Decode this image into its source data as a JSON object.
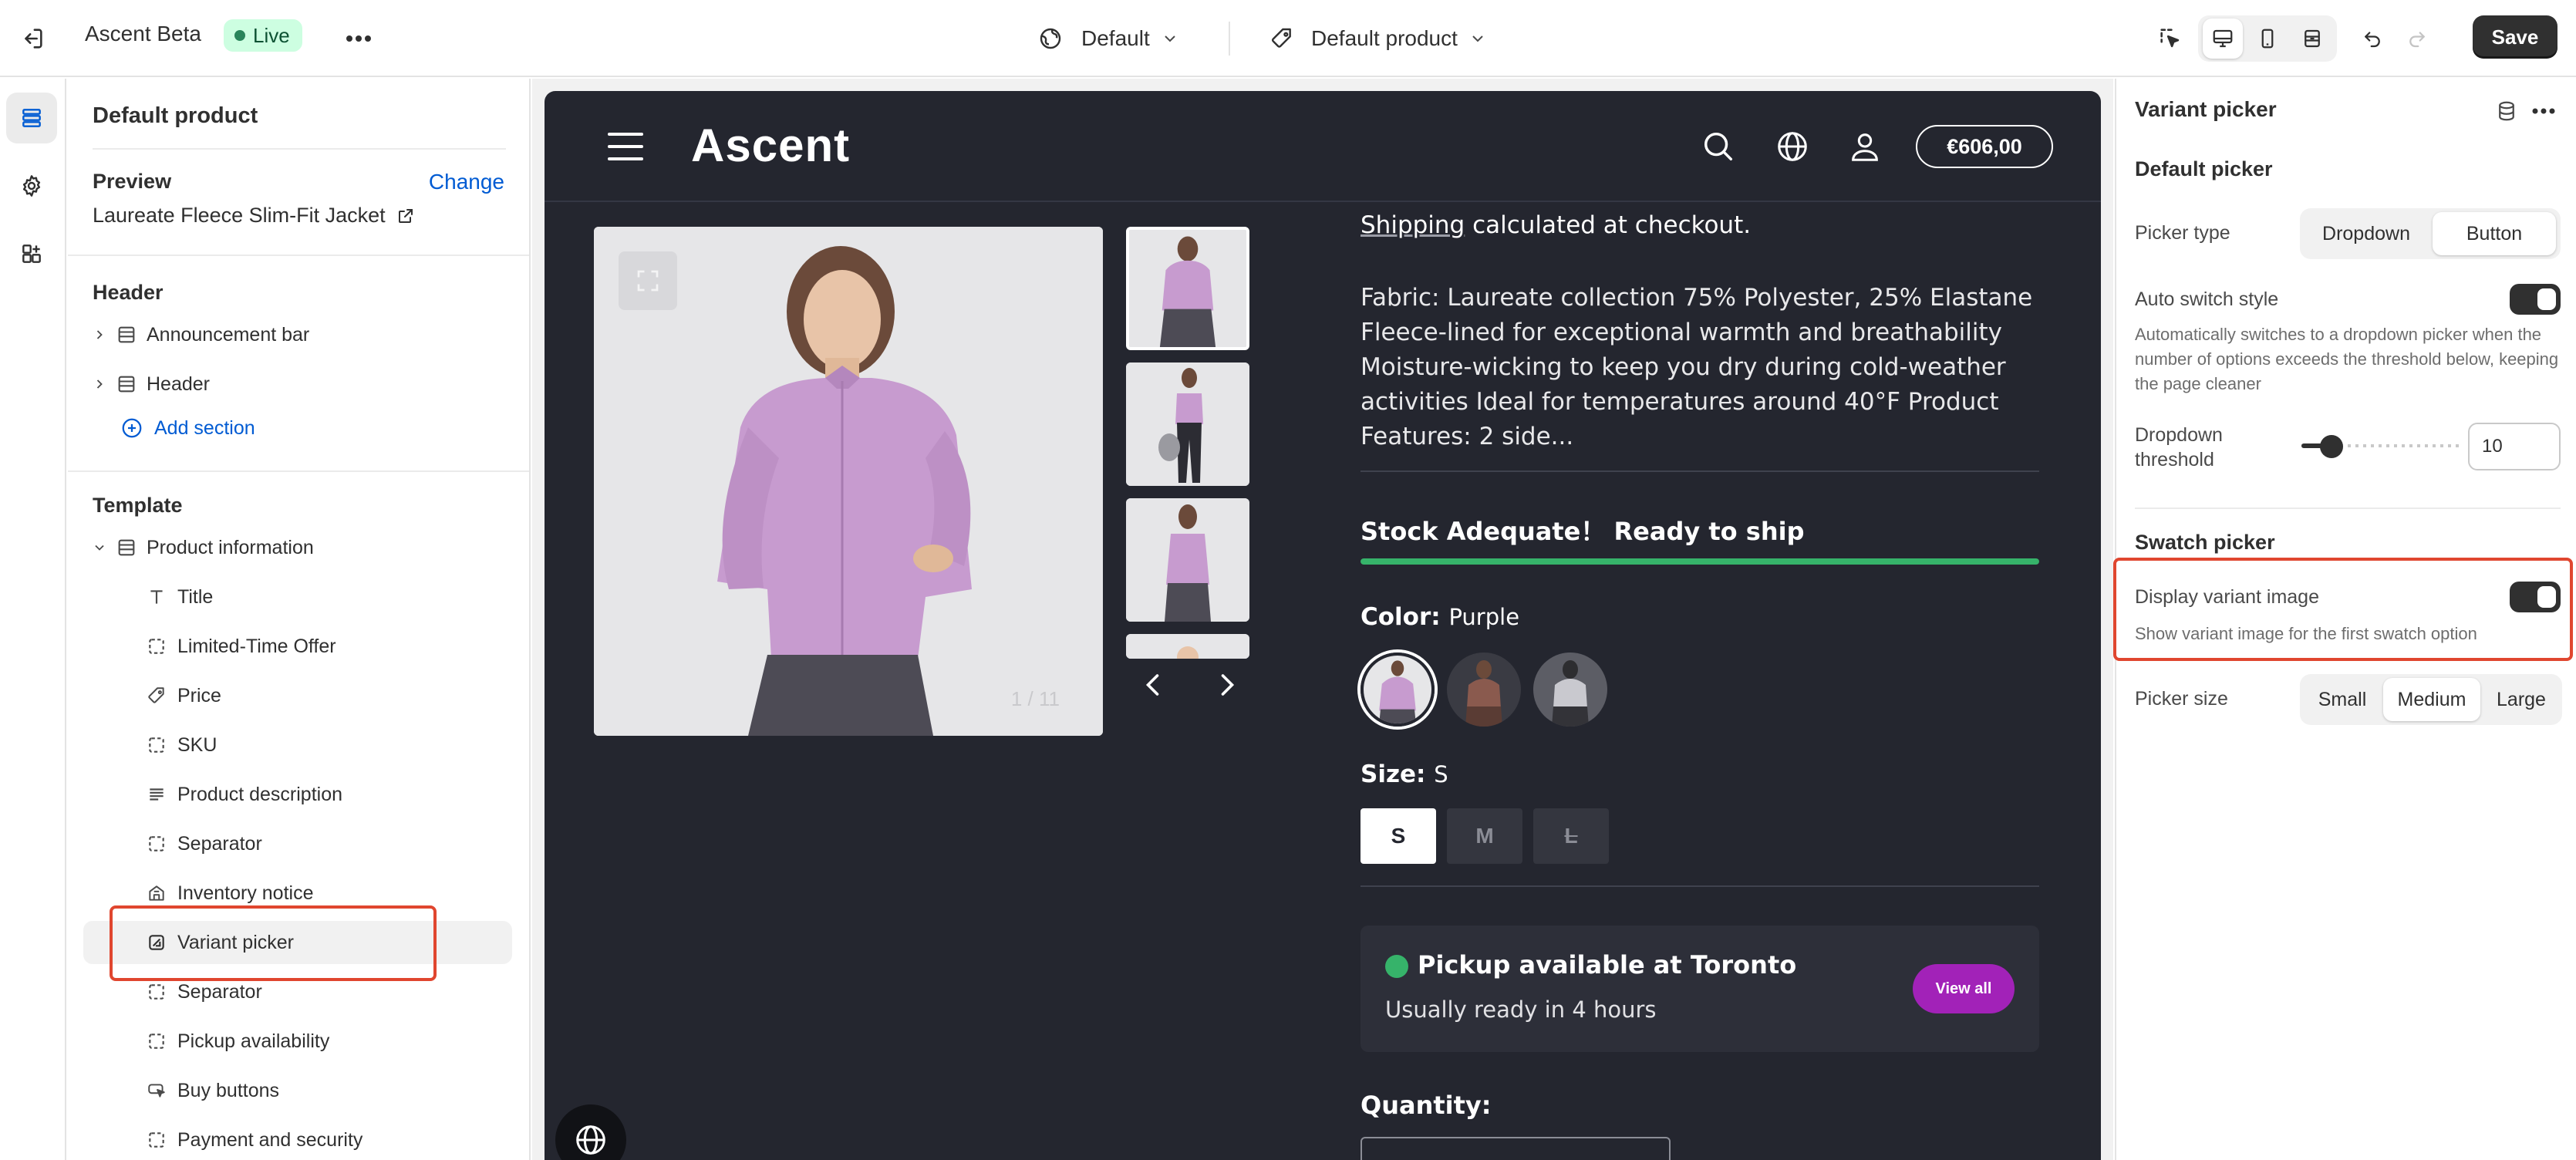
{
  "app": {
    "theme_name": "Ascent Beta",
    "status_badge": "Live",
    "theme_selector": "Default",
    "template_selector": "Default product",
    "save_label": "Save"
  },
  "left_panel": {
    "title": "Default product",
    "preview_heading": "Preview",
    "change_link": "Change",
    "preview_product": "Laureate Fleece Slim-Fit Jacket",
    "header_heading": "Header",
    "header_items": [
      "Announcement bar",
      "Header"
    ],
    "add_section": "Add section",
    "template_heading": "Template",
    "template_section": "Product information",
    "blocks": [
      {
        "label": "Title",
        "icon": "text-icon"
      },
      {
        "label": "Limited-Time Offer",
        "icon": "block-icon"
      },
      {
        "label": "Price",
        "icon": "price-tag-icon"
      },
      {
        "label": "SKU",
        "icon": "block-icon"
      },
      {
        "label": "Product description",
        "icon": "paragraph-icon"
      },
      {
        "label": "Separator",
        "icon": "block-icon"
      },
      {
        "label": "Inventory notice",
        "icon": "store-icon"
      },
      {
        "label": "Variant picker",
        "icon": "variant-icon"
      },
      {
        "label": "Separator",
        "icon": "block-icon"
      },
      {
        "label": "Pickup availability",
        "icon": "block-icon"
      },
      {
        "label": "Buy buttons",
        "icon": "cursor-button-icon"
      },
      {
        "label": "Payment and security",
        "icon": "block-icon"
      }
    ],
    "selected_block": "Variant picker"
  },
  "store": {
    "logo": "Ascent",
    "cart_total": "€606,00",
    "image_counter": "1 / 11",
    "shipping_link": "Shipping",
    "shipping_text": " calculated at checkout.",
    "description": "Fabric: Laureate collection 75% Polyester, 25% Elastane Fleece-lined for exceptional warmth and breathability Moisture-wicking to keep you dry during cold-weather activities Ideal for temperatures around 40°F Product Features: 2 side...",
    "stock_text": "Stock Adequate！ Ready to ship",
    "stock_level": 1.0,
    "color_label": "Color:",
    "color_value": "Purple",
    "size_label": "Size:",
    "size_value": "S",
    "sizes": [
      "S",
      "M",
      "L"
    ],
    "pickup_title": "Pickup available at Toronto",
    "pickup_sub": "Usually ready in 4 hours",
    "view_all": "View all",
    "quantity_label": "Quantity:",
    "colors": {
      "background": "#24262f",
      "accent": "#a222b8",
      "success": "#36b36a"
    }
  },
  "right_panel": {
    "title": "Variant picker",
    "default_heading": "Default picker",
    "picker_type_label": "Picker type",
    "picker_type_options": [
      "Dropdown",
      "Button"
    ],
    "picker_type_selected": "Button",
    "auto_switch_label": "Auto switch style",
    "auto_switch_on": true,
    "auto_switch_help": "Automatically switches to a dropdown picker when the number of options exceeds the threshold below, keeping the page cleaner",
    "threshold_label": "Dropdown threshold",
    "threshold_value": "10",
    "swatch_heading": "Swatch picker",
    "display_image_label": "Display variant image",
    "display_image_on": true,
    "display_image_help": "Show variant image for the first swatch option",
    "picker_size_label": "Picker size",
    "picker_size_options": [
      "Small",
      "Medium",
      "Large"
    ],
    "picker_size_selected": "Medium"
  }
}
